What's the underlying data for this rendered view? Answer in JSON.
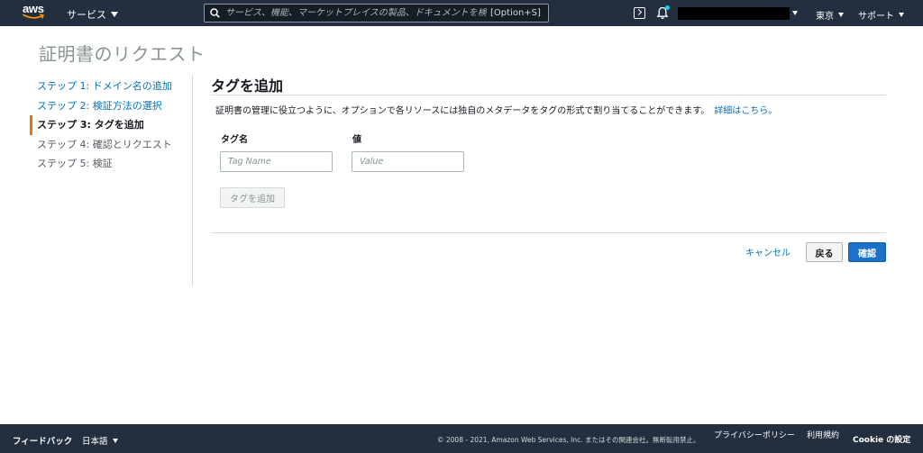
{
  "topnav": {
    "logo_text": "aws",
    "services_label": "サービス",
    "search_placeholder": "サービス、機能、マーケットプレイスの製品、ドキュメントを検索",
    "search_shortcut": "[Option+S]",
    "region_label": "東京",
    "support_label": "サポート",
    "icons": [
      "cloudshell-icon",
      "bell-icon",
      "search-icon"
    ]
  },
  "page": {
    "title": "証明書のリクエスト"
  },
  "steps": [
    {
      "label": "ステップ 1: ドメイン名の追加",
      "state": "link"
    },
    {
      "label": "ステップ 2: 検証方法の選択",
      "state": "link"
    },
    {
      "label": "ステップ 3: タグを追加",
      "state": "active"
    },
    {
      "label": "ステップ 4: 確認とリクエスト",
      "state": "future"
    },
    {
      "label": "ステップ 5: 検証",
      "state": "future"
    }
  ],
  "main": {
    "section_title": "タグを追加",
    "description": "証明書の管理に役立つように、オプションで各リソースには独自のメタデータをタグの形式で割り当てることができます。",
    "details_link": "詳細はこちら。",
    "column_key": "タグ名",
    "column_value": "値",
    "key_placeholder": "Tag Name",
    "value_placeholder": "Value",
    "add_tag_button": "タグを追加",
    "cancel_link": "キャンセル",
    "back_button": "戻る",
    "confirm_button": "確認"
  },
  "footer": {
    "feedback": "フィードバック",
    "language": "日本語",
    "copyright": "© 2008 - 2021, Amazon Web Services, Inc. またはその関連会社。無断転用禁止。",
    "privacy": "プライバシーポリシー",
    "terms": "利用規約",
    "cookie": "Cookie の設定"
  },
  "colors": {
    "nav_bg": "#232f3e",
    "link": "#0073bb",
    "active_step_bar": "#ec7211",
    "primary_button": "#1a73c8"
  }
}
